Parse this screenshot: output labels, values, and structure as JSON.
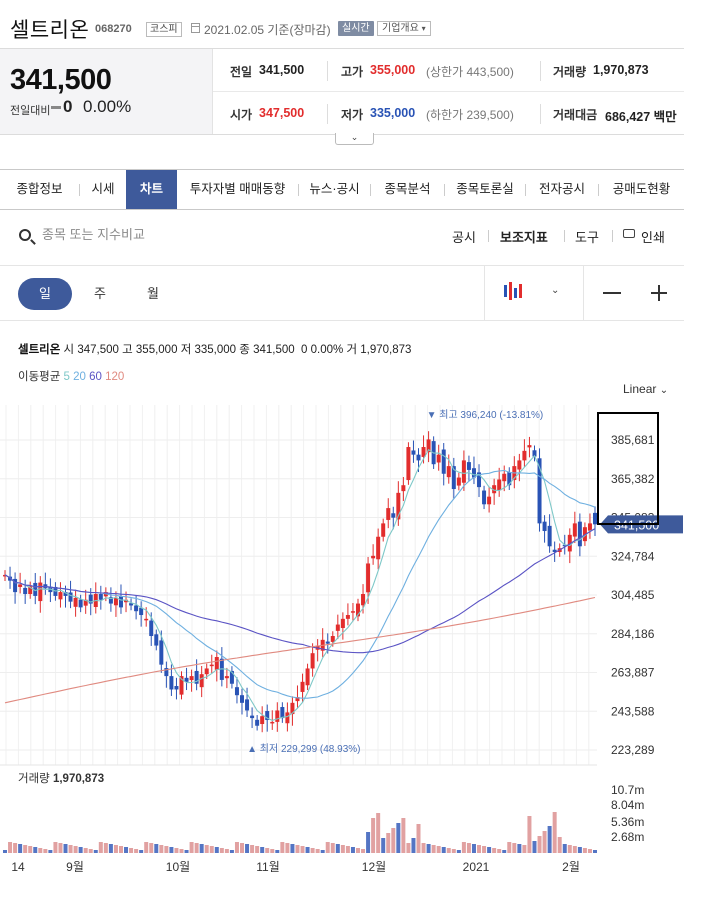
{
  "header": {
    "name": "셀트리온",
    "code": "068270",
    "market": "코스피",
    "date": "2021.02.05 기준(장마감)",
    "realtime": "실시간",
    "company_info": "기업개요"
  },
  "price": {
    "current": "341,500",
    "change_label": "전일대비",
    "change": "0",
    "change_pct": "0.00%"
  },
  "stats": {
    "prev_label": "전일",
    "prev": "341,500",
    "high_label": "고가",
    "high": "355,000",
    "upper_limit": "(상한가 443,500)",
    "volume_label": "거래량",
    "volume": "1,970,873",
    "open_label": "시가",
    "open": "347,500",
    "low_label": "저가",
    "low": "335,000",
    "lower_limit": "(하한가 239,500)",
    "amount_label": "거래대금",
    "amount": "686,427 백만"
  },
  "tabs": [
    "종합정보",
    "시세",
    "차트",
    "투자자별 매매동향",
    "뉴스·공시",
    "종목분석",
    "종목토론실",
    "전자공시",
    "공매도현황"
  ],
  "active_tab": 2,
  "search": {
    "placeholder": "종목 또는 지수비교"
  },
  "tools": {
    "notice": "공시",
    "indicator": "보조지표",
    "tool": "도구",
    "print": "인쇄"
  },
  "periods": [
    "일",
    "주",
    "월"
  ],
  "info_line": {
    "name": "셀트리온",
    "open_label": "시",
    "open": "347,500",
    "high_label": "고",
    "high": "355,000",
    "low_label": "저",
    "low": "335,000",
    "close_label": "종",
    "close": "341,500",
    "chg": "0",
    "chg_pct": "0.00%",
    "vol_label": "거",
    "vol": "1,970,873"
  },
  "ma_legend": {
    "label": "이동평균",
    "p5": "5",
    "p20": "20",
    "p60": "60",
    "p120": "120"
  },
  "scale_mode": "Linear",
  "volume_title": "거래량",
  "volume_value": "1,970,873",
  "colors": {
    "up": "#e22d2d",
    "down": "#2953b5",
    "accent": "#3e5a9b",
    "ma5": "#7ec8c8",
    "ma20": "#6fb0e0",
    "ma60": "#5a53c4",
    "ma120": "#e08a80"
  },
  "chart_data": {
    "type": "candlestick",
    "y_ticks": [
      "385,681",
      "365,382",
      "345,083",
      "324,784",
      "304,485",
      "284,186",
      "263,887",
      "243,588",
      "223,289"
    ],
    "ylim": [
      220000,
      405000
    ],
    "x_labels": [
      "14",
      "9월",
      "10월",
      "11월",
      "12월",
      "2021",
      "2월"
    ],
    "last_price_label": "341,500",
    "max_marker": "최고 396,240 (-13.81%)",
    "min_marker": "최저 229,299 (48.93%)",
    "closes": [
      315000,
      312000,
      306000,
      310000,
      305000,
      309000,
      304000,
      311000,
      308000,
      306000,
      304000,
      306000,
      304000,
      301000,
      303000,
      298000,
      302000,
      300000,
      305000,
      302000,
      306000,
      300000,
      303000,
      298000,
      302000,
      299000,
      296000,
      294000,
      292000,
      283000,
      278000,
      268000,
      262000,
      255000,
      255000,
      262000,
      259000,
      262000,
      258000,
      263000,
      266000,
      268000,
      272000,
      260000,
      262000,
      258000,
      252000,
      248000,
      244000,
      240000,
      236000,
      241000,
      239000,
      238000,
      244000,
      240000,
      243000,
      248000,
      251000,
      259000,
      266000,
      274000,
      278000,
      281000,
      279000,
      283000,
      289000,
      292000,
      294000,
      296000,
      300000,
      305000,
      321000,
      325000,
      335000,
      342000,
      350000,
      345000,
      358000,
      362000,
      382000,
      378000,
      375000,
      382000,
      386000,
      373000,
      378000,
      368000,
      372000,
      360000,
      366000,
      375000,
      370000,
      366000,
      361000,
      352000,
      356000,
      362000,
      365000,
      368000,
      362000,
      372000,
      375000,
      380000,
      383000,
      377000,
      342000,
      338000,
      330000,
      327000,
      329000,
      330000,
      336000,
      342000,
      330000,
      340000,
      342000,
      341500
    ],
    "volume_ticks": [
      "10.7m",
      "8.04m",
      "5.36m",
      "2.68m"
    ]
  }
}
